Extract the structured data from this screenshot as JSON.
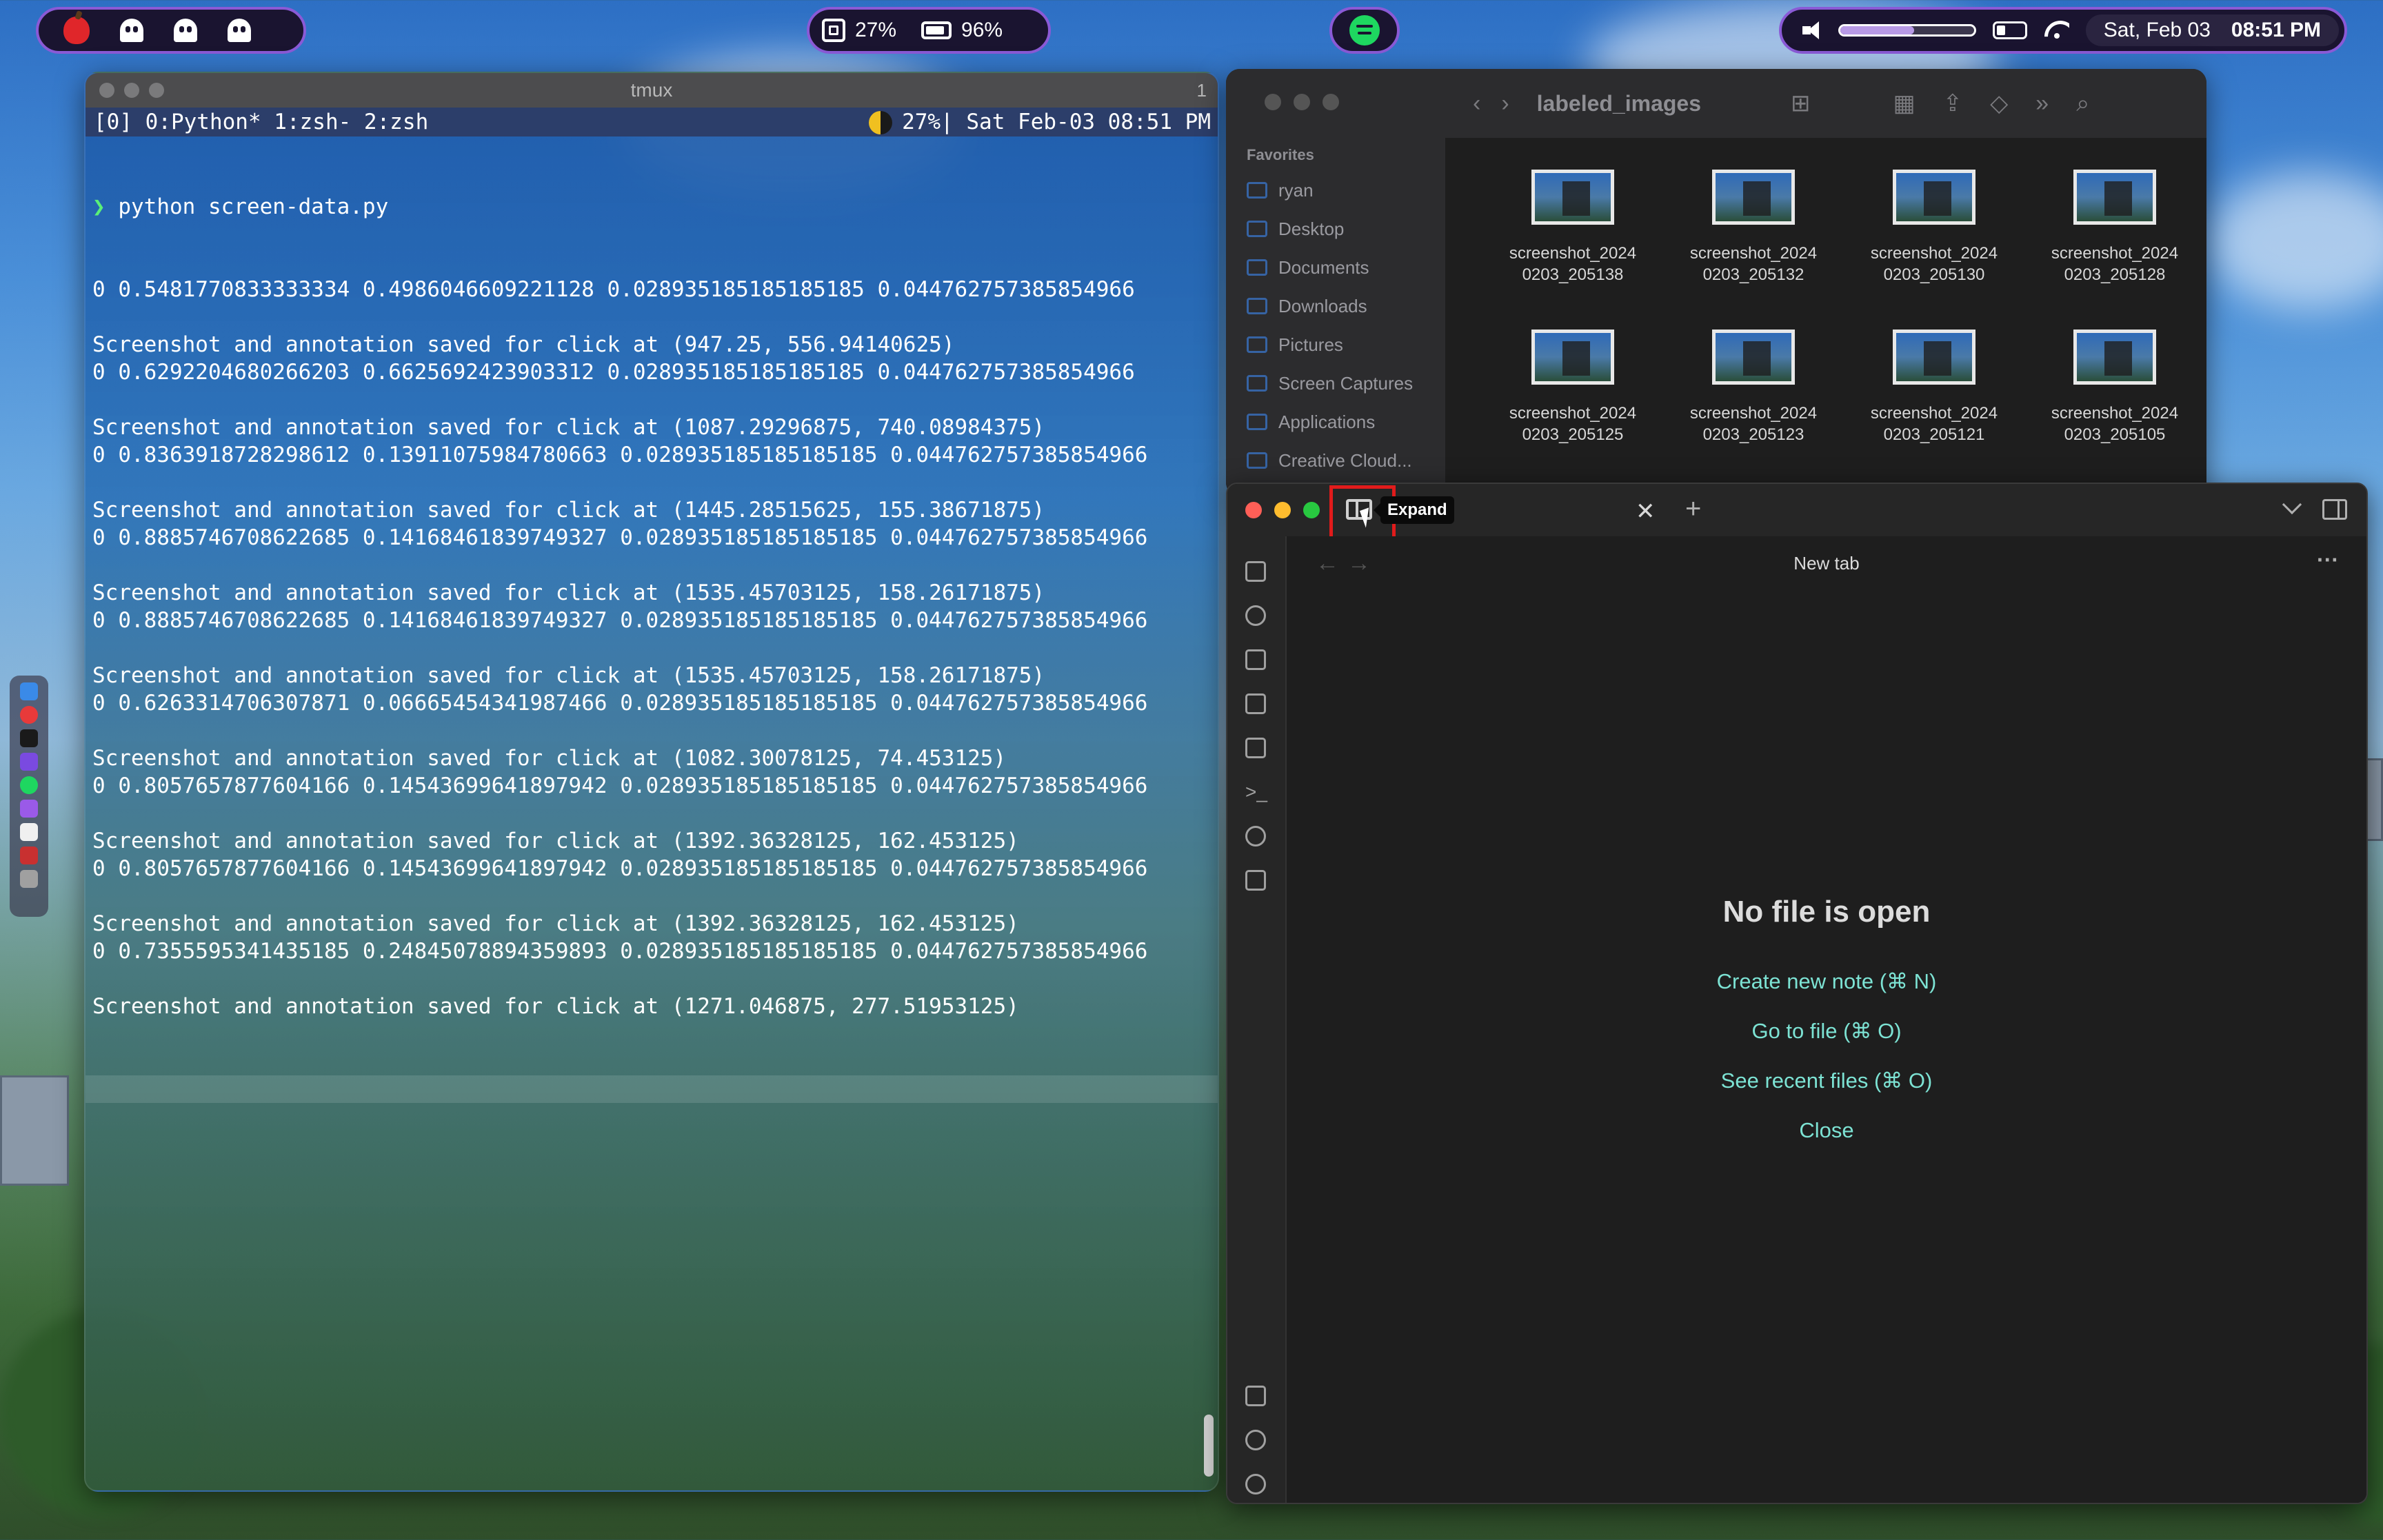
{
  "menubar": {
    "cpu_percent": "27%",
    "battery_percent": "96%",
    "volume_level": 0.55,
    "date": "Sat, Feb 03",
    "time": "08:51 PM"
  },
  "terminal": {
    "window_title": "tmux",
    "window_number": "1",
    "status_left": "[0] 0:Python* 1:zsh- 2:zsh",
    "status_right": "27%| Sat Feb-03 08:51 PM",
    "command": "python screen-data.py",
    "lines": [
      "0 0.5481770833333334 0.4986046609221128 0.028935185185185185 0.044762757385854966",
      "",
      "Screenshot and annotation saved for click at (947.25, 556.94140625)",
      "0 0.6292204680266203 0.6625692423903312 0.028935185185185185 0.044762757385854966",
      "",
      "Screenshot and annotation saved for click at (1087.29296875, 740.08984375)",
      "0 0.8363918728298612 0.13911075984780663 0.028935185185185185 0.044762757385854966",
      "",
      "Screenshot and annotation saved for click at (1445.28515625, 155.38671875)",
      "0 0.8885746708622685 0.14168461839749327 0.028935185185185185 0.044762757385854966",
      "",
      "Screenshot and annotation saved for click at (1535.45703125, 158.26171875)",
      "0 0.8885746708622685 0.14168461839749327 0.028935185185185185 0.044762757385854966",
      "",
      "Screenshot and annotation saved for click at (1535.45703125, 158.26171875)",
      "0 0.6263314706307871 0.06665454341987466 0.028935185185185185 0.044762757385854966",
      "",
      "Screenshot and annotation saved for click at (1082.30078125, 74.453125)",
      "0 0.8057657877604166 0.14543699641897942 0.028935185185185185 0.044762757385854966",
      "",
      "Screenshot and annotation saved for click at (1392.36328125, 162.453125)",
      "0 0.8057657877604166 0.14543699641897942 0.028935185185185185 0.044762757385854966",
      "",
      "Screenshot and annotation saved for click at (1392.36328125, 162.453125)",
      "0 0.7355595341435185 0.24845078894359893 0.028935185185185185 0.044762757385854966",
      "",
      "Screenshot and annotation saved for click at (1271.046875, 277.51953125)"
    ]
  },
  "finder": {
    "folder_title": "labeled_images",
    "favorites_heading": "Favorites",
    "favorites": [
      "ryan",
      "Desktop",
      "Documents",
      "Downloads",
      "Pictures",
      "Screen Captures",
      "Applications",
      "Creative Cloud..."
    ],
    "files": [
      {
        "line1": "screenshot_2024",
        "line2": "0203_205138"
      },
      {
        "line1": "screenshot_2024",
        "line2": "0203_205132"
      },
      {
        "line1": "screenshot_2024",
        "line2": "0203_205130"
      },
      {
        "line1": "screenshot_2024",
        "line2": "0203_205128"
      },
      {
        "line1": "screenshot_2024",
        "line2": "0203_205125"
      },
      {
        "line1": "screenshot_2024",
        "line2": "0203_205123"
      },
      {
        "line1": "screenshot_2024",
        "line2": "0203_205121"
      },
      {
        "line1": "screenshot_2024",
        "line2": "0203_205105"
      }
    ]
  },
  "obsidian": {
    "tooltip": "Expand",
    "tab_title": "New tab",
    "empty_title": "No file is open",
    "actions": {
      "create": "Create new note (⌘ N)",
      "goto": "Go to file (⌘ O)",
      "recent": "See recent files (⌘ O)",
      "close": "Close"
    },
    "accent_color": "#7de3d4"
  }
}
